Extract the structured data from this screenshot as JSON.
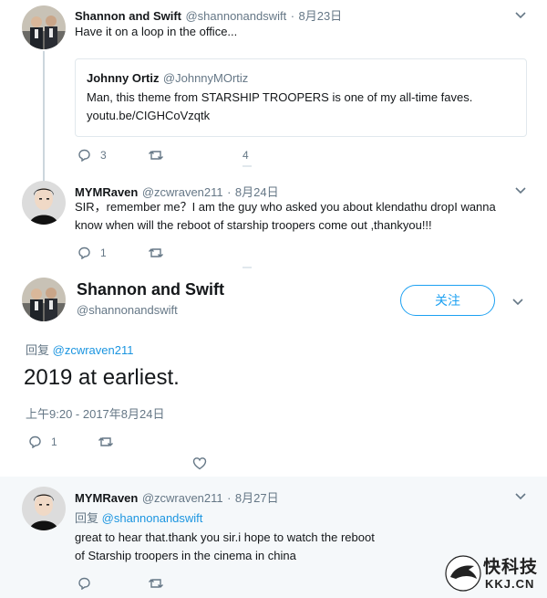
{
  "tweet1": {
    "name": "Shannon and Swift",
    "handle": "@shannonandswift",
    "date": "8月23日",
    "text": "Have it on a loop in the office...",
    "quote": {
      "name": "Johnny Ortiz",
      "handle": "@JohnnyMOrtiz",
      "text": "Man, this theme from STARSHIP TROOPERS is one of my all-time faves.",
      "link": "youtu.be/CIGHCoVzqtk"
    },
    "replies": "3",
    "likes": "4"
  },
  "tweet2": {
    "name": "MYMRaven",
    "handle": "@zcwraven211",
    "date": "8月24日",
    "text_line1": "SIR，remember me？I am the guy who asked you about klendathu dropI wanna",
    "text_line2": "know when will the reboot of starship troopers come out ,thankyou!!!",
    "replies": "1"
  },
  "main_tweet": {
    "name": "Shannon and Swift",
    "handle": "@shannonandswift",
    "follow_label": "关注",
    "reply_prefix": "回复",
    "reply_to": "@zcwraven211",
    "text": "2019 at earliest.",
    "timestamp": "上午9:20 - 2017年8月24日",
    "replies": "1"
  },
  "tweet3": {
    "name": "MYMRaven",
    "handle": "@zcwraven211",
    "date": "8月27日",
    "reply_prefix": "回复",
    "reply_to": "@shannonandswift",
    "text_line1": "great to hear that.thank you sir.i hope to watch the reboot",
    "text_line2": "of Starship troopers in the cinema in china"
  },
  "watermark": {
    "brand": "快科技",
    "domain": "KKJ.CN"
  },
  "colors": {
    "accent": "#1da1f2",
    "muted": "#657786",
    "thread": "#ccd6dd"
  }
}
